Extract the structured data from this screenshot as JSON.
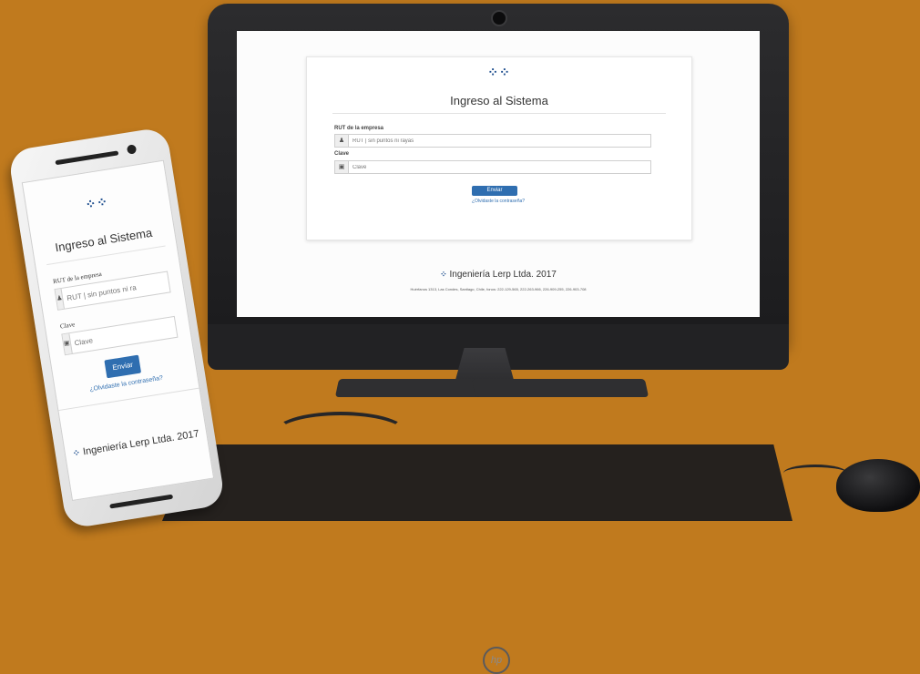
{
  "colors": {
    "background": "#c07a1e",
    "accent": "#2f6eb0",
    "logo": "#1f4f8f"
  },
  "logo_glyph": "⁘⁘",
  "desktop": {
    "title": "Ingreso al Sistema",
    "rut_label": "RUT de la empresa",
    "rut_placeholder": "RUT | sin puntos ni rayas",
    "clave_label": "Clave",
    "clave_placeholder": "Clave",
    "submit_label": "Enviar",
    "forgot_link": "¿Olvidaste la contraseña?",
    "footer_brand": "Ingeniería Lerp Ltda. 2017",
    "footer_address": "Huérfanos 1313, Las Condes, Santiago, Chile, fonos: 222-129-565, 222-263-966, 226-909-255, 226-903-708",
    "monitor_logo": "hp"
  },
  "mobile": {
    "title": "Ingreso al Sistema",
    "rut_label": "RUT de la empresa",
    "rut_placeholder": "RUT | sin puntos ni ra",
    "clave_label": "Clave",
    "clave_placeholder": "Clave",
    "submit_label": "Enviar",
    "forgot_link": "¿Olvidaste la contraseña?",
    "footer_brand": "Ingeniería Lerp Ltda. 2017"
  },
  "icons": {
    "user": "user-icon",
    "lock": "lock-icon",
    "logo": "company-logo-icon"
  }
}
